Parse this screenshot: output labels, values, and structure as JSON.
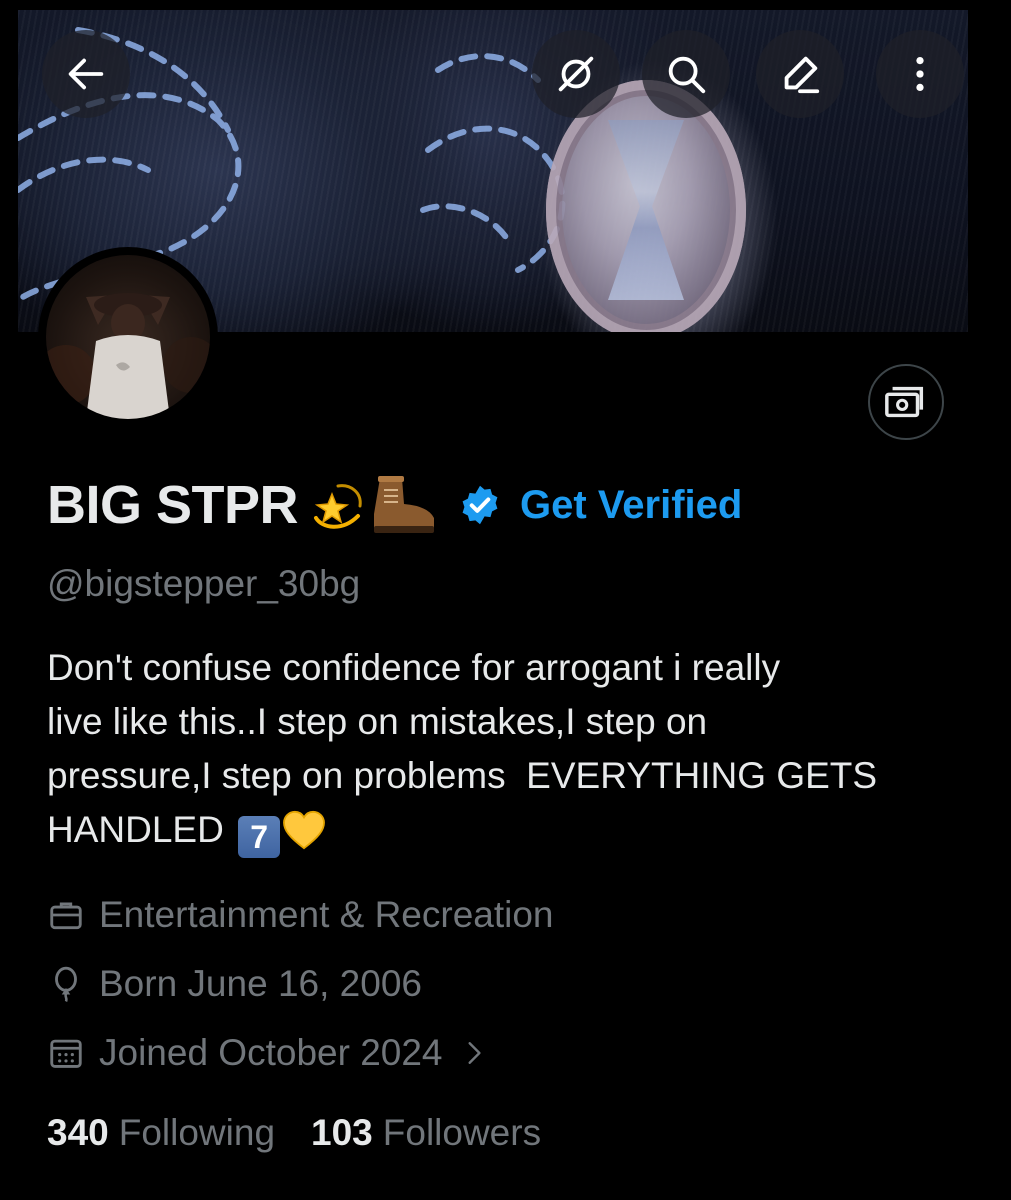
{
  "header": {
    "back_icon": "arrow-left-icon",
    "grok_icon": "grok-icon",
    "search_icon": "search-icon",
    "edit_icon": "edit-icon",
    "more_icon": "more-vertical-icon"
  },
  "profile": {
    "display_name": "BIG STPR",
    "name_emojis": [
      "dizzy-star-emoji",
      "work-boot-emoji"
    ],
    "verified_icon": "verified-badge-icon",
    "get_verified_label": "Get Verified",
    "handle": "@bigstepper_30bg",
    "bio_text": "Don't confuse confidence for arrogant i really\nlive like this..I step on mistakes,I step on\npressure,I step on problems  EVERYTHING GETS\nHANDLED ",
    "bio_keycap": "7",
    "bio_heart_icon": "yellow-heart-emoji",
    "category_icon": "briefcase-icon",
    "category": "Entertainment & Recreation",
    "birthday_icon": "balloon-icon",
    "birthday": "Born June 16, 2006",
    "joined_icon": "calendar-icon",
    "joined": "Joined October 2024",
    "following_count": "340",
    "following_label": "Following",
    "followers_count": "103",
    "followers_label": "Followers"
  },
  "actions": {
    "money_icon": "money-icon"
  },
  "colors": {
    "accent": "#1d9bf0",
    "text_primary": "#e7e9ea",
    "text_secondary": "#71767b",
    "background": "#000000"
  }
}
